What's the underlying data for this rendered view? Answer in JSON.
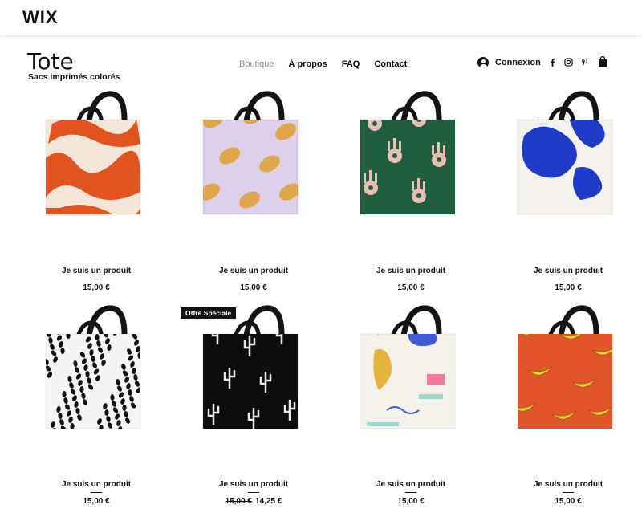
{
  "wix_bar": {
    "logo": "WIX"
  },
  "site": {
    "title": "Tote",
    "subtitle": "Sacs imprimés colorés"
  },
  "nav": {
    "items": [
      {
        "label": "Boutique",
        "active": true
      },
      {
        "label": "À propos",
        "active": false
      },
      {
        "label": "FAQ",
        "active": false
      },
      {
        "label": "Contact",
        "active": false
      }
    ]
  },
  "header_right": {
    "login_label": "Connexion",
    "social_icons": [
      "facebook-icon",
      "instagram-icon",
      "pinterest-icon"
    ],
    "cart_icon": "shopping-bag-icon"
  },
  "products": [
    {
      "name": "Je suis un produit",
      "price": "15,00 €",
      "pattern": "orange-brush",
      "colors": [
        "#f3e6d8",
        "#e2541f"
      ]
    },
    {
      "name": "Je suis un produit",
      "price": "15,00 €",
      "pattern": "lemons",
      "colors": [
        "#dcd0ea",
        "#e1a64a"
      ]
    },
    {
      "name": "Je suis un produit",
      "price": "15,00 €",
      "pattern": "hands",
      "colors": [
        "#1f5e3f",
        "#e9bfb4"
      ]
    },
    {
      "name": "Je suis un produit",
      "price": "15,00 €",
      "pattern": "blue-blobs",
      "colors": [
        "#f4f1ed",
        "#1f3cc9"
      ]
    },
    {
      "name": "Je suis un produit",
      "price": "15,00 €",
      "pattern": "dots",
      "colors": [
        "#f5f5f3",
        "#111111"
      ]
    },
    {
      "name": "Je suis un produit",
      "old_price": "15,00 €",
      "price": "14,25 €",
      "badge": "Offre Spéciale",
      "pattern": "cactus",
      "colors": [
        "#0d0d0d",
        "#e8e8e8"
      ]
    },
    {
      "name": "Je suis un produit",
      "price": "15,00 €",
      "pattern": "abstract",
      "colors": [
        "#f4f0ea",
        "#3f5bd6"
      ]
    },
    {
      "name": "Je suis un produit",
      "price": "15,00 €",
      "pattern": "bananas",
      "colors": [
        "#e2552a",
        "#f2cf2c"
      ]
    }
  ]
}
